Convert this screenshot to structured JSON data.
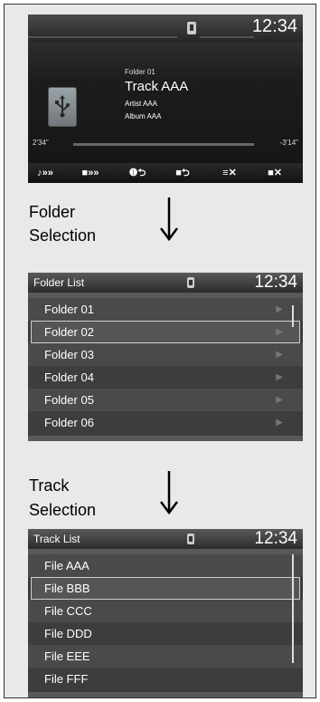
{
  "playback": {
    "clock": "12:34",
    "folder": "Folder 01",
    "track": "Track AAA",
    "artist": "Artist AAA",
    "album": "Album AAA",
    "elapsed": "2'34\"",
    "remaining": "-3'14\"",
    "controls": [
      "♪»»",
      "■»»",
      "❶⮌",
      "■⮌",
      "≡✕",
      "■✕"
    ]
  },
  "caption_folder": [
    "Folder",
    "Selection"
  ],
  "caption_track": [
    "Track",
    "Selection"
  ],
  "folder_list": {
    "title": "Folder List",
    "clock": "12:34",
    "items": [
      "Folder 01",
      "Folder 02",
      "Folder 03",
      "Folder 04",
      "Folder 05",
      "Folder 06"
    ],
    "selected_index": 1
  },
  "track_list": {
    "title": "Track List",
    "clock": "12:34",
    "items": [
      "File AAA",
      "File BBB",
      "File CCC",
      "File DDD",
      "File EEE",
      "File FFF"
    ],
    "selected_index": 1
  }
}
